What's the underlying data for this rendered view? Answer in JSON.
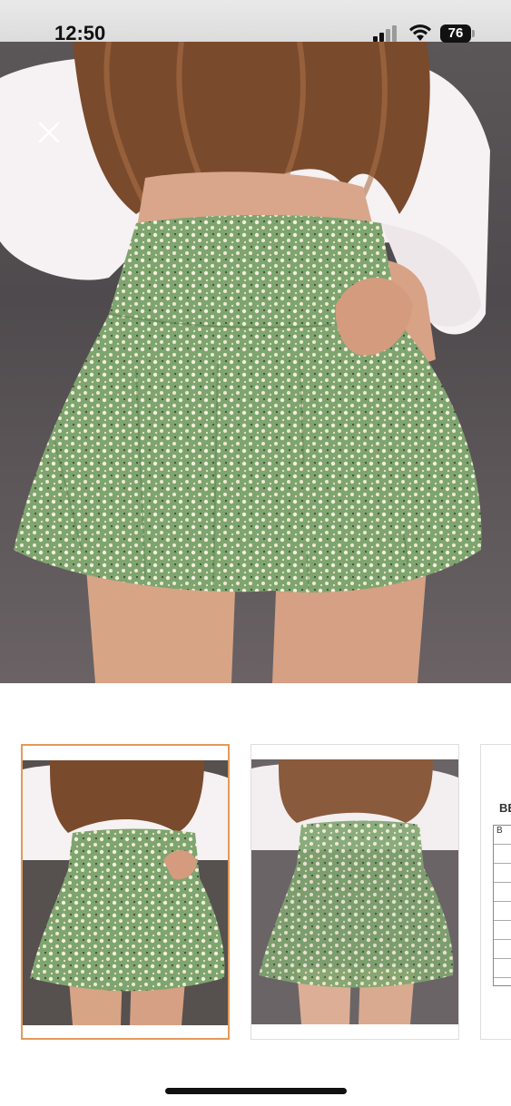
{
  "status_bar": {
    "time": "12:50",
    "battery": "76",
    "icons": [
      "signal-icon",
      "wifi-icon",
      "battery-icon"
    ]
  },
  "hero": {
    "close_icon": "close-icon"
  },
  "thumbnails": {
    "selected_index": 0,
    "selected_border_color": "#e39a5b",
    "size_chart_title": "BE",
    "size_chart_header": "B"
  }
}
